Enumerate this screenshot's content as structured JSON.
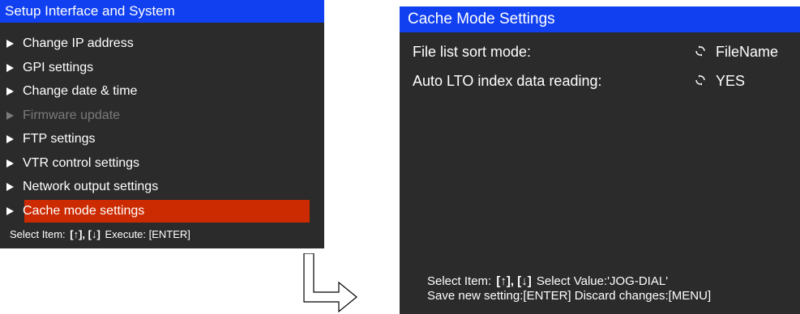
{
  "left": {
    "title": "Setup Interface and System",
    "items": [
      {
        "label": "Change IP address",
        "state": "normal"
      },
      {
        "label": "GPI settings",
        "state": "normal"
      },
      {
        "label": "Change date & time",
        "state": "normal"
      },
      {
        "label": "Firmware update",
        "state": "disabled"
      },
      {
        "label": "FTP settings",
        "state": "normal"
      },
      {
        "label": "VTR control settings",
        "state": "normal"
      },
      {
        "label": "Network output settings",
        "state": "normal"
      },
      {
        "label": "Cache mode settings",
        "state": "selected"
      }
    ],
    "footer": {
      "select_text": "Select Item:",
      "keys": "[↑], [↓]",
      "execute_text": "Execute: [ENTER]"
    }
  },
  "right": {
    "title": "Cache Mode Settings",
    "settings": [
      {
        "label": "File list sort mode:",
        "value": "FileName"
      },
      {
        "label": "Auto LTO index data reading:",
        "value": "YES"
      }
    ],
    "footer": {
      "line1_prefix": "Select Item:",
      "keys": "[↑], [↓]",
      "line1_suffix": "Select Value:'JOG-DIAL'",
      "line2": "Save new setting:[ENTER] Discard changes:[MENU]"
    }
  },
  "colors": {
    "title_bar": "#1040f0",
    "panel_bg": "#2b2b2b",
    "selection": "#cc2a00",
    "disabled_text": "#7a7a7a"
  },
  "icons": {
    "menu_marker": "right-triangle-icon",
    "value_marker": "cycle-arrows-icon",
    "transition": "down-right-arrow-icon"
  }
}
